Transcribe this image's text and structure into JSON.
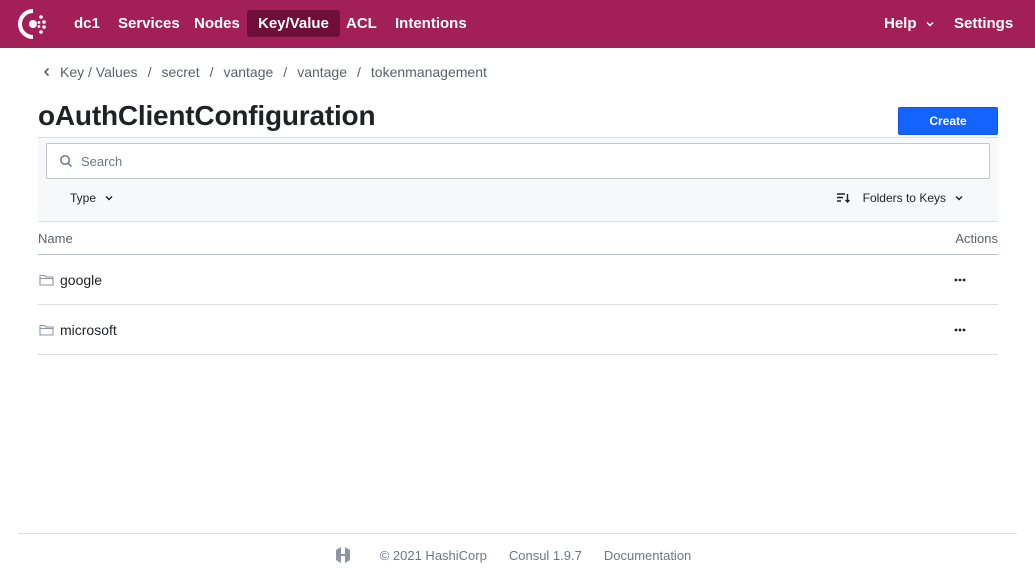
{
  "nav": {
    "logo_icon": "consul-logo-icon",
    "datacenter": "dc1",
    "items": [
      {
        "label": "Services"
      },
      {
        "label": "Nodes"
      },
      {
        "label": "Key/Value",
        "active": true
      },
      {
        "label": "ACL"
      },
      {
        "label": "Intentions"
      }
    ],
    "help": "Help",
    "settings": "Settings",
    "background_color": "#a21f57",
    "active_color": "#6f0f39"
  },
  "breadcrumb": {
    "back_icon": "chevron-left-icon",
    "items": [
      "Key / Values",
      "secret",
      "vantage",
      "vantage",
      "tokenmanagement"
    ],
    "separator": "/"
  },
  "page": {
    "title": "oAuthClientConfiguration",
    "create_label": "Create",
    "create_color": "#1563ff"
  },
  "filters": {
    "search_placeholder": "Search",
    "search_value": "",
    "type_label": "Type",
    "sort_label": "Folders to Keys"
  },
  "table": {
    "headers": {
      "name": "Name",
      "actions": "Actions"
    },
    "rows": [
      {
        "name": "google",
        "icon": "folder-icon"
      },
      {
        "name": "microsoft",
        "icon": "folder-icon"
      }
    ]
  },
  "footer": {
    "logo_icon": "hashicorp-logo-icon",
    "copyright": "© 2021 HashiCorp",
    "version": "Consul 1.9.7",
    "docs": "Documentation"
  }
}
